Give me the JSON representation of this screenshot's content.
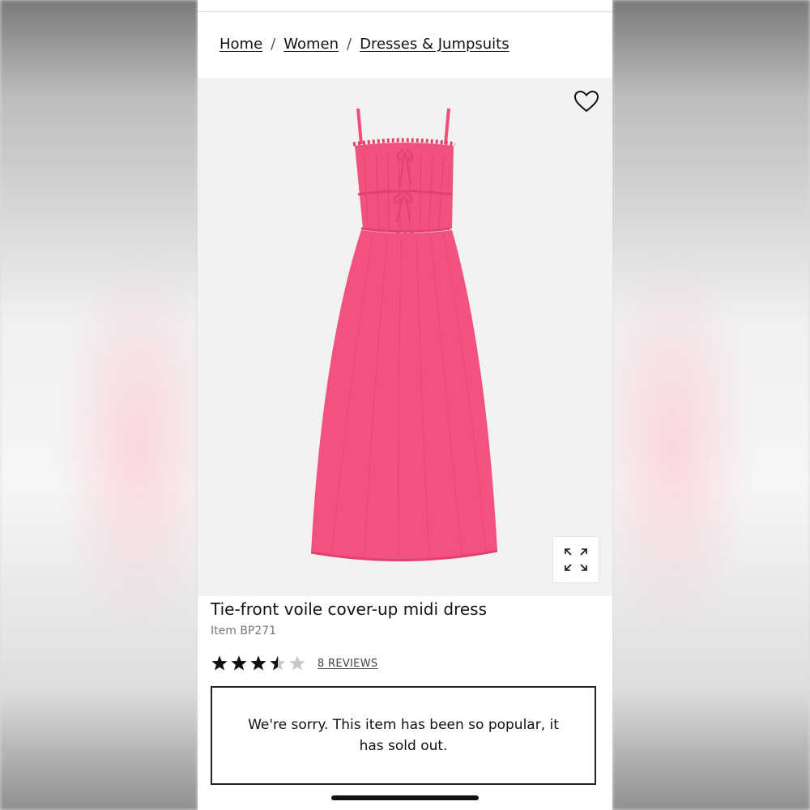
{
  "breadcrumb": {
    "items": [
      "Home",
      "Women",
      "Dresses & Jumpsuits"
    ],
    "separator": "/"
  },
  "product": {
    "title": "Tie-front voile cover-up midi dress",
    "item_number": "Item BP271",
    "rating": 3.5,
    "rating_max": 5,
    "reviews_label": "8 REVIEWS",
    "dress_color": "#f2537e"
  },
  "notice": {
    "message": "We're sorry. This item has been so popular, it has sold out."
  },
  "icons": {
    "wishlist": "heart-icon",
    "expand": "expand-icon"
  }
}
